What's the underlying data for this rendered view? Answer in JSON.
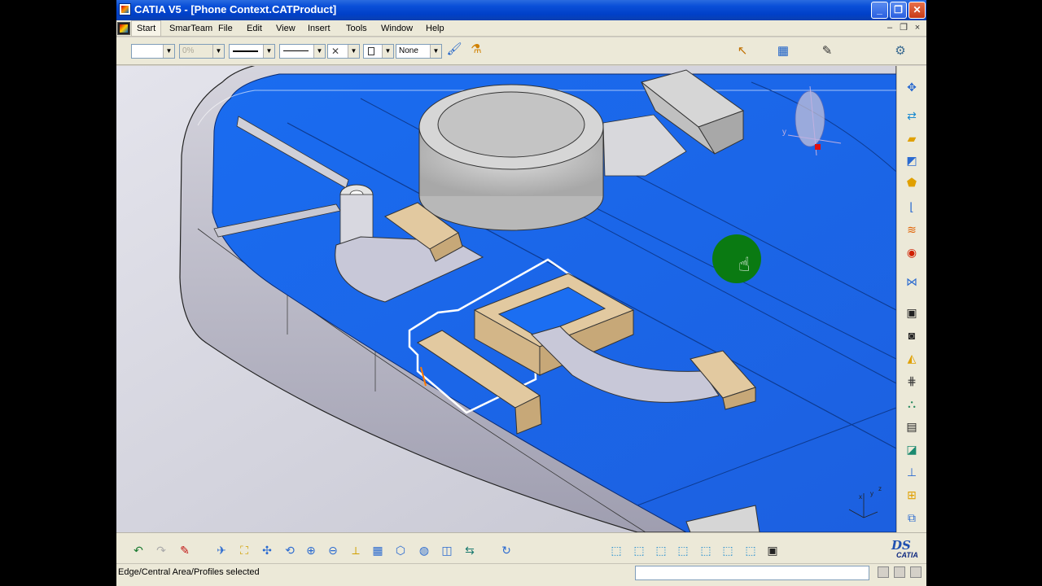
{
  "window": {
    "title": "CATIA V5 - [Phone Context.CATProduct]",
    "minimize_glyph": "_",
    "restore_glyph": "❐",
    "close_glyph": "✕"
  },
  "menubar": {
    "items": [
      "Start",
      "SmarTeam",
      "File",
      "Edit",
      "View",
      "Insert",
      "Tools",
      "Window",
      "Help"
    ],
    "doc_minimize": "–",
    "doc_restore": "❐",
    "doc_close": "×"
  },
  "toolbar": {
    "percent_value": "0%",
    "layer_value": "None",
    "icons": [
      "fill-color-icon",
      "transparency-icon",
      "line-thickness-icon",
      "line-type-icon",
      "point-type-icon",
      "rendering-style-icon",
      "layer-icon",
      "painter-icon",
      "properties-icon",
      "select-icon",
      "catalog-icon",
      "sketcher-icon",
      "knowledge-icon"
    ]
  },
  "viewport": {
    "compass_axis_y": "y",
    "axis_labels": [
      "x",
      "y",
      "z"
    ],
    "colors": {
      "phone_tray": "#1b6ef2",
      "shell": "#c9c7d3",
      "component_tan": "#e2c9a0",
      "highlight_profile": "#ffffff",
      "cursor_marker": "#0a7a12"
    }
  },
  "right_toolbar": {
    "icons": [
      "isolate-icon",
      "move-icon",
      "pad-icon",
      "surface-icon",
      "extrude-icon",
      "profile-icon",
      "offset-icon",
      "boolean-icon",
      "assembly-icon",
      "sketch-icon",
      "sketch-plane-icon",
      "shell-icon",
      "grid-icon",
      "analysis-icon",
      "save-icon",
      "fill-icon",
      "constraint-icon",
      "measure-icon",
      "flatten-icon"
    ]
  },
  "bottom_toolbar": {
    "icons": [
      "undo-icon",
      "redo-icon",
      "pen-icon",
      "fly-mode-icon",
      "fit-all-icon",
      "pan-icon",
      "rotate-icon",
      "zoom-in-icon",
      "zoom-out-icon",
      "normal-view-icon",
      "multi-view-icon",
      "iso-view-icon",
      "render-style-icon",
      "hide-show-icon",
      "swap-space-icon",
      "update-icon",
      "view-front-icon",
      "view-back-icon",
      "view-left-icon",
      "view-right-icon",
      "view-top-icon",
      "view-bottom-icon",
      "view-iso-icon",
      "camera-icon"
    ],
    "logo_ds": "DS",
    "logo_catia": "CATIA"
  },
  "statusbar": {
    "message": "Edge/Central Area/Profiles selected",
    "command_input": ""
  }
}
